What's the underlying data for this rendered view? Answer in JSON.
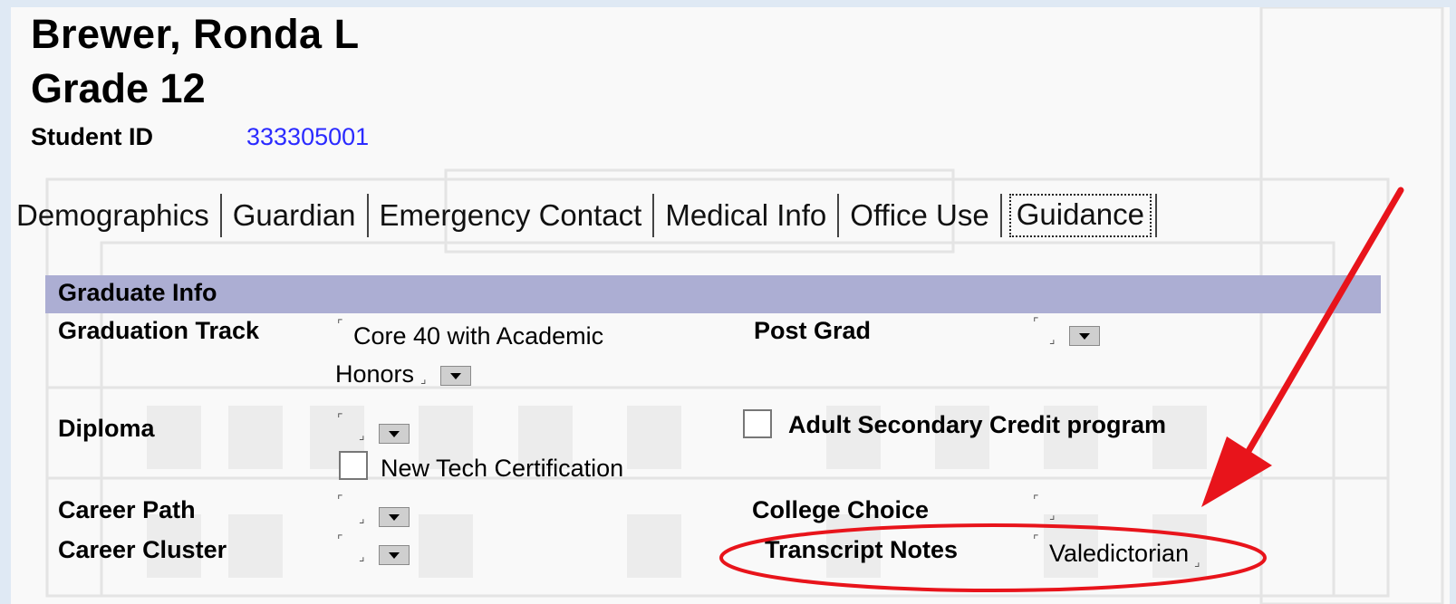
{
  "student": {
    "name": "Brewer, Ronda L",
    "grade": "Grade 12",
    "student_id_label": "Student ID",
    "student_id": "333305001"
  },
  "tabs": [
    {
      "label": "Demographics"
    },
    {
      "label": "Guardian"
    },
    {
      "label": "Emergency Contact"
    },
    {
      "label": "Medical Info"
    },
    {
      "label": "Office Use"
    },
    {
      "label": "Guidance",
      "active": true
    }
  ],
  "section": {
    "title": "Graduate Info"
  },
  "fields": {
    "graduation_track": {
      "label": "Graduation Track",
      "value_line1": "Core 40 with Academic",
      "value_line2": "Honors"
    },
    "post_grad": {
      "label": "Post Grad",
      "value": ""
    },
    "diploma": {
      "label": "Diploma",
      "value": ""
    },
    "adult_secondary": {
      "label": "Adult Secondary Credit program",
      "checked": false
    },
    "new_tech": {
      "label": "New Tech Certification",
      "checked": false
    },
    "career_path": {
      "label": "Career Path",
      "value": ""
    },
    "college_choice": {
      "label": "College Choice",
      "value": ""
    },
    "career_cluster": {
      "label": "Career Cluster",
      "value": ""
    },
    "transcript_notes": {
      "label": "Transcript Notes",
      "value": "Valedictorian"
    }
  },
  "annotation": {
    "color": "#e8141b"
  }
}
